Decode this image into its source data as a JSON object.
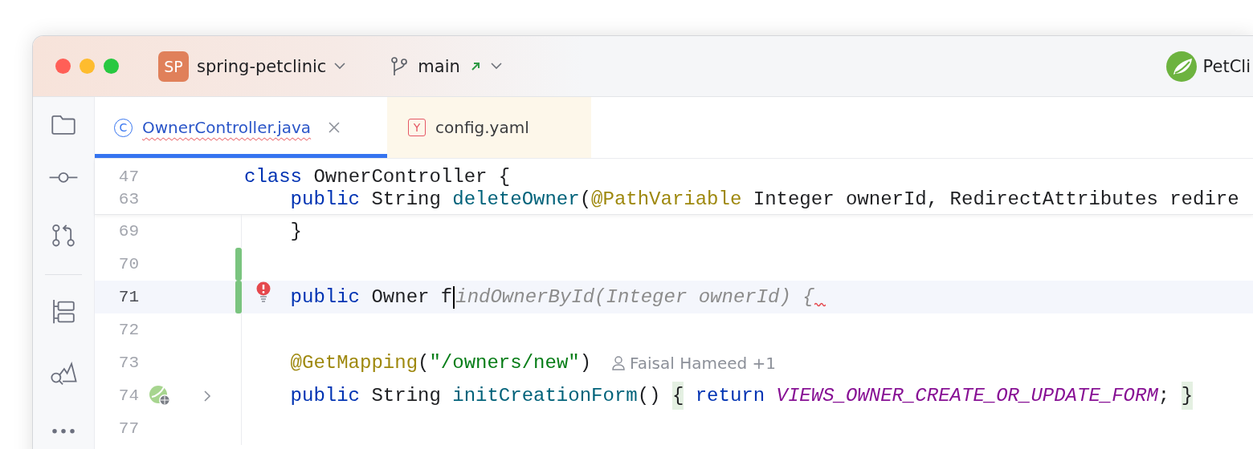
{
  "title_bar": {
    "project": {
      "badge": "SP",
      "name": "spring-petclinic"
    },
    "branch": {
      "name": "main"
    },
    "run_config": {
      "label": "PetCli"
    }
  },
  "sidebar": {
    "items": [
      {
        "kind": "folder"
      },
      {
        "kind": "commit"
      },
      {
        "kind": "pull-requests"
      },
      {
        "kind": "divider"
      },
      {
        "kind": "structure"
      },
      {
        "kind": "services"
      },
      {
        "kind": "more"
      }
    ]
  },
  "tabs": [
    {
      "label": "OwnerController.java",
      "icon_letter": "C",
      "kind": "java",
      "selected": true,
      "has_error": true
    },
    {
      "label": "config.yaml",
      "icon_letter": "Y",
      "kind": "yaml",
      "selected": false,
      "has_error": false
    }
  ],
  "editor": {
    "sticky_lines": [
      {
        "number": "47",
        "indented": false,
        "tokens": [
          {
            "kind": "keyword",
            "text": "class"
          },
          {
            "kind": "plain",
            "text": " OwnerController {"
          }
        ]
      },
      {
        "number": "63",
        "indented": true,
        "tokens": [
          {
            "kind": "keyword",
            "text": "public"
          },
          {
            "kind": "plain",
            "text": " String "
          },
          {
            "kind": "method",
            "text": "deleteOwner"
          },
          {
            "kind": "plain",
            "text": "("
          },
          {
            "kind": "annotation",
            "text": "@PathVariable"
          },
          {
            "kind": "plain",
            "text": " Integer ownerId, RedirectAttributes redire"
          }
        ]
      }
    ],
    "lines": [
      {
        "number": "69",
        "kind": "plain",
        "current": false,
        "changed": false,
        "indented": true,
        "tokens": [
          {
            "kind": "plain",
            "text": "}"
          }
        ]
      },
      {
        "number": "70",
        "kind": "plain",
        "current": false,
        "changed": true
      },
      {
        "number": "71",
        "kind": "bulb",
        "current": true,
        "changed": true,
        "indented": true,
        "tokens": [
          {
            "kind": "keyword",
            "text": "public"
          },
          {
            "kind": "plain",
            "text": " Owner f"
          },
          {
            "kind": "hint",
            "text": "indOwnerById(Integer ownerId) {",
            "caret_before": true,
            "error_after": true
          }
        ]
      },
      {
        "number": "72",
        "kind": "plain",
        "current": false,
        "changed": false
      },
      {
        "number": "73",
        "kind": "plain",
        "current": false,
        "changed": false,
        "indented": true,
        "tokens": [
          {
            "kind": "annotation",
            "text": "@GetMapping"
          },
          {
            "kind": "plain",
            "text": "("
          },
          {
            "kind": "string",
            "text": "\"/owners/new\""
          },
          {
            "kind": "plain",
            "text": ")"
          },
          {
            "kind": "author",
            "text": "Faisal Hameed +1"
          }
        ]
      },
      {
        "number": "74",
        "kind": "bean",
        "current": false,
        "changed": false,
        "indented": true,
        "tokens": [
          {
            "kind": "keyword",
            "text": "public"
          },
          {
            "kind": "plain",
            "text": " String "
          },
          {
            "kind": "method",
            "text": "initCreationForm"
          },
          {
            "kind": "plain",
            "text": "() "
          },
          {
            "kind": "brace",
            "text": "{"
          },
          {
            "kind": "keyword",
            "text": " return"
          },
          {
            "kind": "constant",
            "text": " VIEWS_OWNER_CREATE_OR_UPDATE_FORM"
          },
          {
            "kind": "plain",
            "text": "; "
          },
          {
            "kind": "brace",
            "text": "}"
          }
        ]
      },
      {
        "number": "77",
        "kind": "plain",
        "current": false,
        "changed": false
      }
    ]
  }
}
